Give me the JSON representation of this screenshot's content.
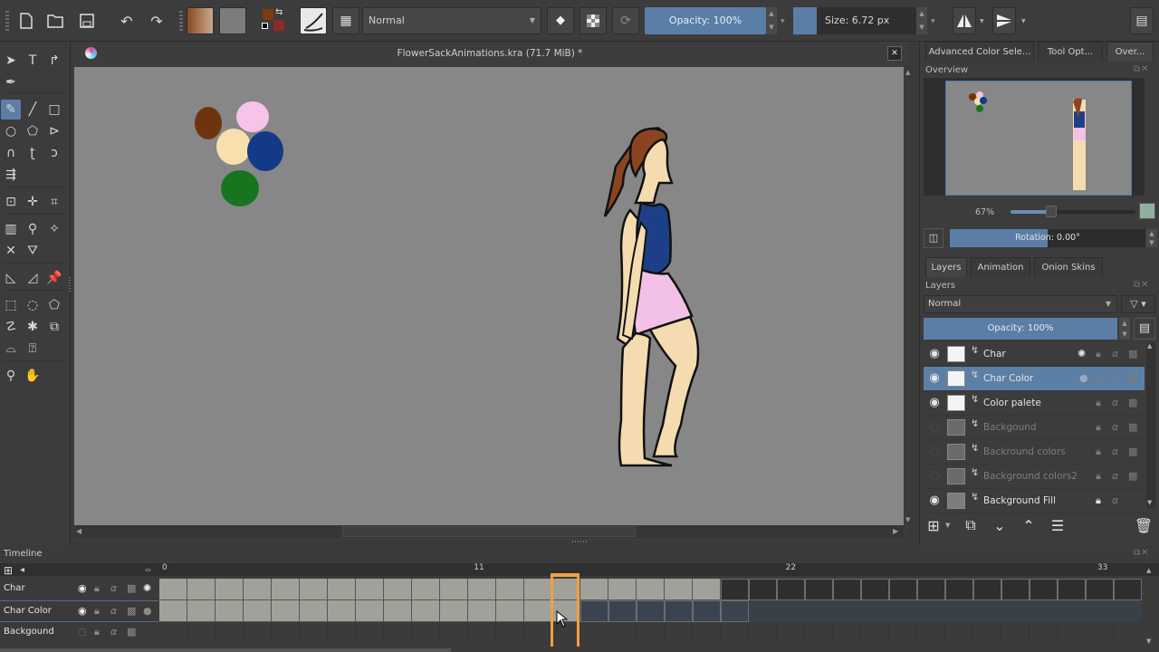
{
  "toolbar": {
    "buttons": [
      {
        "name": "new-document",
        "icon": "📄"
      },
      {
        "name": "open-document",
        "icon": "🗀"
      },
      {
        "name": "save-document",
        "icon": "💾"
      },
      {
        "name": "undo",
        "icon": "↶"
      },
      {
        "name": "redo",
        "icon": "↷"
      }
    ],
    "gradient_icon": "gradient-preset",
    "pattern_icon": "pattern-preset",
    "foreground_color": "#7a3a12",
    "background_color": "#8a2a2a",
    "brush_preset_icon": "brush-preset",
    "workspace_icon": "▦",
    "blend_mode": "Normal",
    "eraser_icon": "⌫",
    "alpha_lock_icon": "▩",
    "reload_icon": "⟳",
    "opacity_label": "Opacity: 100%",
    "size_label": "Size: 6.72 px",
    "mirror_h_icon": "◭",
    "mirror_v_icon": "▶",
    "window_menu_icon": "▤"
  },
  "toolbox": {
    "tools": [
      {
        "name": "select-shapes",
        "icon": "➤"
      },
      {
        "name": "text",
        "icon": "T"
      },
      {
        "name": "edit-shapes",
        "icon": "↱"
      },
      {
        "name": "calligraphy",
        "icon": "✒"
      },
      {
        "name": "freehand-brush",
        "icon": "✎",
        "active": true
      },
      {
        "name": "line",
        "icon": "╱"
      },
      {
        "name": "rectangle",
        "icon": "□"
      },
      {
        "name": "ellipse",
        "icon": "○"
      },
      {
        "name": "polygon",
        "icon": "⬠"
      },
      {
        "name": "polyline",
        "icon": "⊳"
      },
      {
        "name": "bezier-curve",
        "icon": "∩"
      },
      {
        "name": "freehand-path",
        "icon": "ʈ"
      },
      {
        "name": "dynamic-brush",
        "icon": "ↄ"
      },
      {
        "name": "multibrush",
        "icon": "⇶"
      },
      {
        "name": "transform",
        "icon": "⊡"
      },
      {
        "name": "move",
        "icon": "✛"
      },
      {
        "name": "crop",
        "icon": "⌗"
      },
      {
        "name": "gradient",
        "icon": "▥"
      },
      {
        "name": "color-picker",
        "icon": "⚲"
      },
      {
        "name": "smart-patch",
        "icon": "✧"
      },
      {
        "name": "fill-assistant",
        "icon": "✕"
      },
      {
        "name": "fill",
        "icon": "⛛"
      },
      {
        "name": "assistant",
        "icon": "◺"
      },
      {
        "name": "measure",
        "icon": "◿"
      },
      {
        "name": "reference-pin",
        "icon": "📌"
      },
      {
        "name": "rect-select",
        "icon": "⬚"
      },
      {
        "name": "ellipse-select",
        "icon": "◌"
      },
      {
        "name": "polygon-select",
        "icon": "⬠"
      },
      {
        "name": "freehand-select",
        "icon": "☡"
      },
      {
        "name": "contiguous-select",
        "icon": "✱"
      },
      {
        "name": "similar-select",
        "icon": "⧉"
      },
      {
        "name": "bezier-select",
        "icon": "⌓"
      },
      {
        "name": "magnetic-select",
        "icon": "⍰"
      },
      {
        "name": "zoom",
        "icon": "⚲"
      },
      {
        "name": "pan",
        "icon": "✋"
      }
    ]
  },
  "document": {
    "title": "FlowerSackAnimations.kra (71.7 MiB) *",
    "close_icon": "✕",
    "palette_colors": [
      "#6e3410",
      "#f8c3e8",
      "#f7dfae",
      "#123a86",
      "#177520"
    ],
    "character": {
      "hair": "#8a4420",
      "skin": "#f5dcb0",
      "top": "#1d3f88",
      "shorts": "#f3c0e6",
      "outline": "#111111"
    }
  },
  "docker": {
    "tabs": [
      "Advanced Color Sele...",
      "Tool Opt...",
      "Over..."
    ],
    "active_tab": 2,
    "overview_title": "Overview",
    "zoom_label": "67%",
    "zoom_fraction": 0.3,
    "rotation_label": "Rotation: 0.00°",
    "layer_tabs": [
      "Layers",
      "Animation",
      "Onion Skins"
    ],
    "layers_title": "Layers",
    "blend_mode": "Normal",
    "opacity_label": "Opacity:  100%",
    "layers": [
      {
        "name": "Char",
        "visible": true,
        "selected": false,
        "dim": false,
        "onion": true,
        "locked": false
      },
      {
        "name": "Char Color",
        "visible": true,
        "selected": true,
        "dim": false,
        "onion": false,
        "locked": false
      },
      {
        "name": "Color palete",
        "visible": true,
        "selected": false,
        "dim": false,
        "onion": false,
        "locked": false
      },
      {
        "name": "Backgound",
        "visible": false,
        "selected": false,
        "dim": true,
        "onion": false,
        "locked": false
      },
      {
        "name": "Backround colors",
        "visible": false,
        "selected": false,
        "dim": true,
        "onion": false,
        "locked": false
      },
      {
        "name": "Background colors2",
        "visible": false,
        "selected": false,
        "dim": true,
        "onion": false,
        "locked": false
      },
      {
        "name": "Background Fill",
        "visible": true,
        "selected": false,
        "dim": false,
        "onion": false,
        "locked": true
      }
    ]
  },
  "timeline": {
    "title": "Timeline",
    "ruler_labels": [
      "0",
      "11",
      "22",
      "33"
    ],
    "current_frame": 14,
    "accent_color": "#f0a040",
    "rows": [
      {
        "name": "Char",
        "visible": true,
        "filled_until": 19,
        "empty_key_until": 35,
        "selected": false,
        "onion": true
      },
      {
        "name": "Char Color",
        "visible": true,
        "filled_until": 14,
        "empty_key_until": 20,
        "selected": true,
        "onion": false
      },
      {
        "name": "Backgound",
        "visible": false,
        "filled_until": -1,
        "empty_key_until": -1,
        "selected": false,
        "onion": false
      }
    ]
  }
}
